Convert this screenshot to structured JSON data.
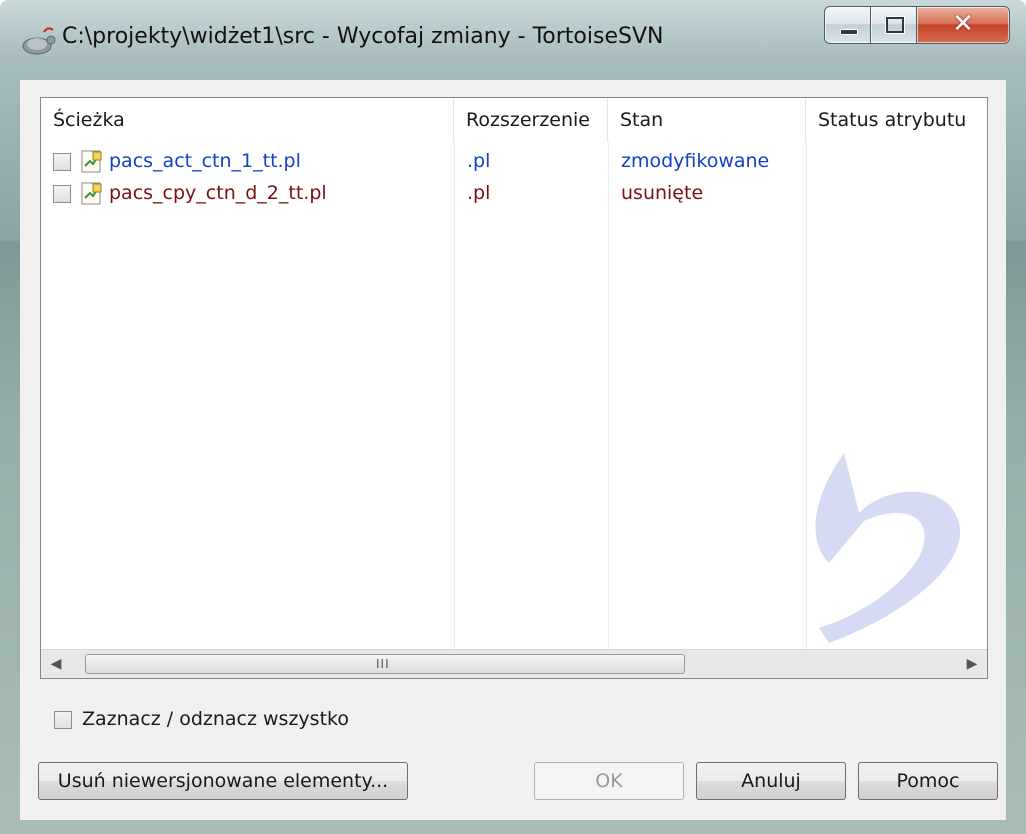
{
  "window": {
    "title": "C:\\projekty\\widżet1\\src - Wycofaj zmiany - TortoiseSVN",
    "close_glyph": "✕",
    "icon": "tortoisesvn-icon"
  },
  "list": {
    "columns": [
      "Ścieżka",
      "Rozszerzenie",
      "Stan",
      "Status atrybutu"
    ],
    "rows": [
      {
        "path": "pacs_act_ctn_1_tt.pl",
        "extension": ".pl",
        "status": "zmodyfikowane",
        "color": "#1540c8",
        "checked": false
      },
      {
        "path": "pacs_cpy_ctn_d_2_tt.pl",
        "extension": ".pl",
        "status": "usunięte",
        "color": "#7a1010",
        "checked": false
      }
    ],
    "scroll_grip": "III"
  },
  "select_all": {
    "label": "Zaznacz / odznacz wszystko",
    "checked": false
  },
  "buttons": {
    "remove_unversioned": "Usuń niewersjonowane elementy...",
    "ok": "OK",
    "cancel": "Anuluj",
    "help": "Pomoc"
  }
}
